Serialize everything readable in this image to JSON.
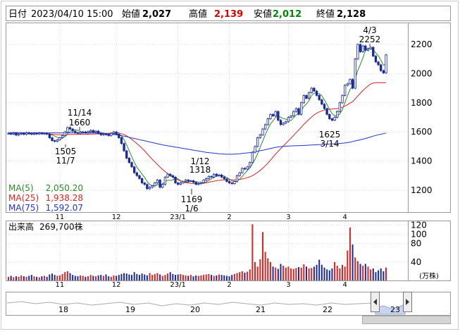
{
  "header": {
    "date_label": "日付",
    "date_value": "2023/04/10 15:00",
    "open_label": "始値",
    "open_value": "2,027",
    "high_label": "高値",
    "high_value": "2,139",
    "low_label": "安値",
    "low_value": "2,012",
    "close_label": "終値",
    "close_value": "2,128"
  },
  "ma_legend": [
    {
      "label": "MA(5)",
      "value": "2,050.20",
      "color": "#2a8a2a"
    },
    {
      "label": "MA(25)",
      "value": "1,938.28",
      "color": "#dd2222"
    },
    {
      "label": "MA(75)",
      "value": "1,592.07",
      "color": "#2233cc"
    }
  ],
  "volume_label": "出来高",
  "volume_value": "269,700株",
  "volume_unit": "(万株)",
  "annotations": [
    {
      "line1": "11/14",
      "line2": "1660"
    },
    {
      "line1": "1505",
      "line2": "11/7"
    },
    {
      "line1": "1/12",
      "line2": "1318"
    },
    {
      "line1": "1169",
      "line2": "1/6"
    },
    {
      "line1": "1625",
      "line2": "3/14"
    },
    {
      "line1": "4/3",
      "line2": "2252"
    }
  ],
  "navigator_labels": [
    "18",
    "19",
    "20",
    "21",
    "22",
    "23"
  ],
  "colors": {
    "up": "#ffffff",
    "down": "#1a2a9a",
    "volume_up": "#dd2222",
    "volume_down": "#1a2a9a",
    "accent_red": "#dd0000",
    "accent_green": "#008800"
  },
  "chart_data": [
    {
      "type": "candlestick",
      "title": "",
      "x_tick_labels": [
        "11",
        "12",
        "23/1",
        "2",
        "3",
        "4"
      ],
      "ylim": [
        1050,
        2350
      ],
      "y_ticks": [
        1200,
        1400,
        1600,
        1800,
        2000,
        2200
      ],
      "grid": true,
      "close": [
        1590,
        1585,
        1592,
        1578,
        1586,
        1590,
        1583,
        1594,
        1588,
        1584,
        1590,
        1586,
        1592,
        1588,
        1590,
        1585,
        1560,
        1540,
        1535,
        1545,
        1560,
        1575,
        1600,
        1630,
        1620,
        1605,
        1595,
        1590,
        1598,
        1600,
        1595,
        1602,
        1610,
        1598,
        1605,
        1590,
        1580,
        1585,
        1582,
        1575,
        1590,
        1600,
        1585,
        1560,
        1520,
        1470,
        1420,
        1390,
        1360,
        1320,
        1300,
        1280,
        1250,
        1240,
        1210,
        1220,
        1230,
        1250,
        1270,
        1220,
        1240,
        1290,
        1310,
        1300,
        1290,
        1250,
        1240,
        1250,
        1260,
        1270,
        1262,
        1265,
        1255,
        1240,
        1245,
        1252,
        1270,
        1280,
        1295,
        1290,
        1310,
        1300,
        1305,
        1290,
        1278,
        1260,
        1250,
        1245,
        1260,
        1300,
        1320,
        1350,
        1345,
        1360,
        1390,
        1460,
        1500,
        1560,
        1580,
        1620,
        1650,
        1690,
        1720,
        1710,
        1740,
        1680,
        1650,
        1660,
        1670,
        1700,
        1710,
        1740,
        1760,
        1720,
        1800,
        1850,
        1830,
        1870,
        1900,
        1880,
        1850,
        1820,
        1790,
        1760,
        1720,
        1690,
        1680,
        1700,
        1740,
        1800,
        1850,
        1920,
        1930,
        1960,
        1900,
        2100,
        2200,
        2150,
        2190,
        2160,
        2170,
        2180,
        2120,
        2080,
        2060,
        2020,
        2005,
        2128
      ],
      "series": [
        {
          "name": "MA(5)",
          "values": [
            1586,
            1586,
            1586,
            1586,
            1586,
            1587,
            1587,
            1587,
            1587,
            1588,
            1588,
            1588,
            1588,
            1588,
            1588,
            1588,
            1584,
            1578,
            1571,
            1563,
            1555,
            1558,
            1568,
            1585,
            1603,
            1612,
            1614,
            1612,
            1602,
            1598,
            1598,
            1598,
            1601,
            1601,
            1602,
            1602,
            1595,
            1592,
            1588,
            1584,
            1582,
            1586,
            1586,
            1582,
            1576,
            1547,
            1511,
            1471,
            1430,
            1392,
            1358,
            1334,
            1310,
            1288,
            1260,
            1240,
            1230,
            1232,
            1238,
            1238,
            1242,
            1262,
            1268,
            1268,
            1270,
            1288,
            1278,
            1266,
            1258,
            1254,
            1256,
            1261,
            1262,
            1258,
            1255,
            1251,
            1252,
            1257,
            1268,
            1277,
            1289,
            1295,
            1300,
            1300,
            1297,
            1287,
            1277,
            1265,
            1259,
            1263,
            1275,
            1295,
            1315,
            1335,
            1353,
            1381,
            1411,
            1451,
            1494,
            1538,
            1582,
            1620,
            1654,
            1676,
            1700,
            1708,
            1700,
            1692,
            1688,
            1682,
            1678,
            1696,
            1716,
            1726,
            1746,
            1774,
            1792,
            1814,
            1850,
            1866,
            1866,
            1862,
            1848,
            1820,
            1788,
            1754,
            1726,
            1710,
            1708,
            1722,
            1754,
            1802,
            1848,
            1892,
            1912,
            1962,
            2022,
            2062,
            2108,
            2160,
            2174,
            2170,
            2164,
            2142,
            2122,
            2092,
            2057,
            2066
          ],
          "color": "#2a8a2a"
        },
        {
          "name": "MA(25)",
          "values": [
            1589,
            1588,
            1588,
            1588,
            1588,
            1588,
            1588,
            1587,
            1587,
            1587,
            1587,
            1587,
            1587,
            1587,
            1587,
            1587,
            1586,
            1584,
            1582,
            1581,
            1580,
            1580,
            1580,
            1581,
            1582,
            1583,
            1583,
            1583,
            1584,
            1584,
            1584,
            1584,
            1585,
            1585,
            1586,
            1587,
            1588,
            1589,
            1590,
            1591,
            1592,
            1594,
            1594,
            1592,
            1588,
            1582,
            1573,
            1562,
            1549,
            1535,
            1520,
            1505,
            1488,
            1470,
            1451,
            1431,
            1412,
            1394,
            1377,
            1359,
            1343,
            1328,
            1314,
            1301,
            1290,
            1280,
            1271,
            1263,
            1257,
            1252,
            1249,
            1247,
            1246,
            1245,
            1245,
            1246,
            1248,
            1251,
            1255,
            1259,
            1262,
            1265,
            1268,
            1270,
            1271,
            1271,
            1271,
            1271,
            1271,
            1272,
            1274,
            1277,
            1281,
            1286,
            1292,
            1300,
            1310,
            1322,
            1336,
            1351,
            1368,
            1386,
            1406,
            1427,
            1448,
            1467,
            1485,
            1503,
            1521,
            1539,
            1557,
            1576,
            1595,
            1613,
            1632,
            1651,
            1669,
            1686,
            1702,
            1717,
            1728,
            1737,
            1744,
            1750,
            1754,
            1756,
            1757,
            1758,
            1760,
            1764,
            1769,
            1777,
            1786,
            1798,
            1808,
            1826,
            1847,
            1865,
            1884,
            1900,
            1915,
            1928,
            1935,
            1938,
            1938,
            1937,
            1937,
            1938
          ],
          "color": "#dd2222"
        },
        {
          "name": "MA(75)",
          "values": [
            1595,
            1595,
            1595,
            1595,
            1595,
            1594,
            1594,
            1594,
            1594,
            1594,
            1594,
            1594,
            1594,
            1594,
            1593,
            1593,
            1593,
            1593,
            1593,
            1593,
            1593,
            1593,
            1593,
            1593,
            1593,
            1593,
            1593,
            1593,
            1592,
            1592,
            1592,
            1592,
            1592,
            1592,
            1592,
            1591,
            1590,
            1589,
            1588,
            1586,
            1584,
            1582,
            1580,
            1577,
            1574,
            1571,
            1567,
            1563,
            1559,
            1555,
            1551,
            1547,
            1543,
            1539,
            1535,
            1531,
            1527,
            1523,
            1519,
            1515,
            1511,
            1508,
            1505,
            1502,
            1499,
            1496,
            1493,
            1490,
            1487,
            1484,
            1481,
            1478,
            1475,
            1472,
            1469,
            1466,
            1463,
            1460,
            1458,
            1456,
            1454,
            1452,
            1450,
            1449,
            1448,
            1447,
            1447,
            1447,
            1448,
            1449,
            1450,
            1452,
            1454,
            1456,
            1458,
            1461,
            1464,
            1468,
            1471,
            1474,
            1478,
            1482,
            1486,
            1490,
            1494,
            1497,
            1499,
            1501,
            1502,
            1503,
            1504,
            1505,
            1505,
            1506,
            1506,
            1507,
            1508,
            1509,
            1510,
            1511,
            1512,
            1513,
            1514,
            1515,
            1516,
            1517,
            1518,
            1519,
            1520,
            1521,
            1522,
            1524,
            1527,
            1530,
            1534,
            1538,
            1542,
            1546,
            1550,
            1555,
            1560,
            1565,
            1571,
            1576,
            1580,
            1584,
            1588,
            1592
          ],
          "color": "#2233cc"
        }
      ]
    },
    {
      "type": "bar",
      "title": "",
      "x_tick_labels": [
        "11",
        "12",
        "23/1",
        "2",
        "3",
        "4"
      ],
      "y_ticks": [
        40,
        80,
        100,
        120
      ],
      "ylim": [
        0,
        130
      ],
      "grid": true,
      "values": [
        8,
        10,
        7,
        9,
        8,
        11,
        9,
        8,
        10,
        12,
        9,
        8,
        7,
        9,
        10,
        8,
        13,
        15,
        12,
        10,
        11,
        14,
        18,
        20,
        16,
        12,
        10,
        9,
        11,
        10,
        8,
        9,
        12,
        10,
        9,
        11,
        12,
        10,
        13,
        9,
        8,
        11,
        10,
        12,
        14,
        16,
        15,
        13,
        12,
        18,
        14,
        12,
        15,
        13,
        11,
        16,
        12,
        14,
        16,
        13,
        10,
        12,
        15,
        18,
        14,
        12,
        13,
        14,
        12,
        11,
        10,
        12,
        9,
        11,
        10,
        11,
        12,
        13,
        14,
        12,
        10,
        11,
        13,
        12,
        11,
        10,
        9,
        12,
        14,
        16,
        18,
        20,
        17,
        19,
        24,
        122,
        40,
        30,
        46,
        105,
        62,
        48,
        40,
        30,
        28,
        25,
        36,
        32,
        28,
        30,
        26,
        25,
        27,
        29,
        28,
        35,
        30,
        26,
        27,
        30,
        34,
        45,
        34,
        28,
        24,
        22,
        26,
        40,
        32,
        26,
        34,
        30,
        65,
        115,
        78,
        50,
        42,
        36,
        32,
        36,
        30,
        24,
        26,
        18,
        22,
        26,
        20,
        28
      ]
    }
  ]
}
